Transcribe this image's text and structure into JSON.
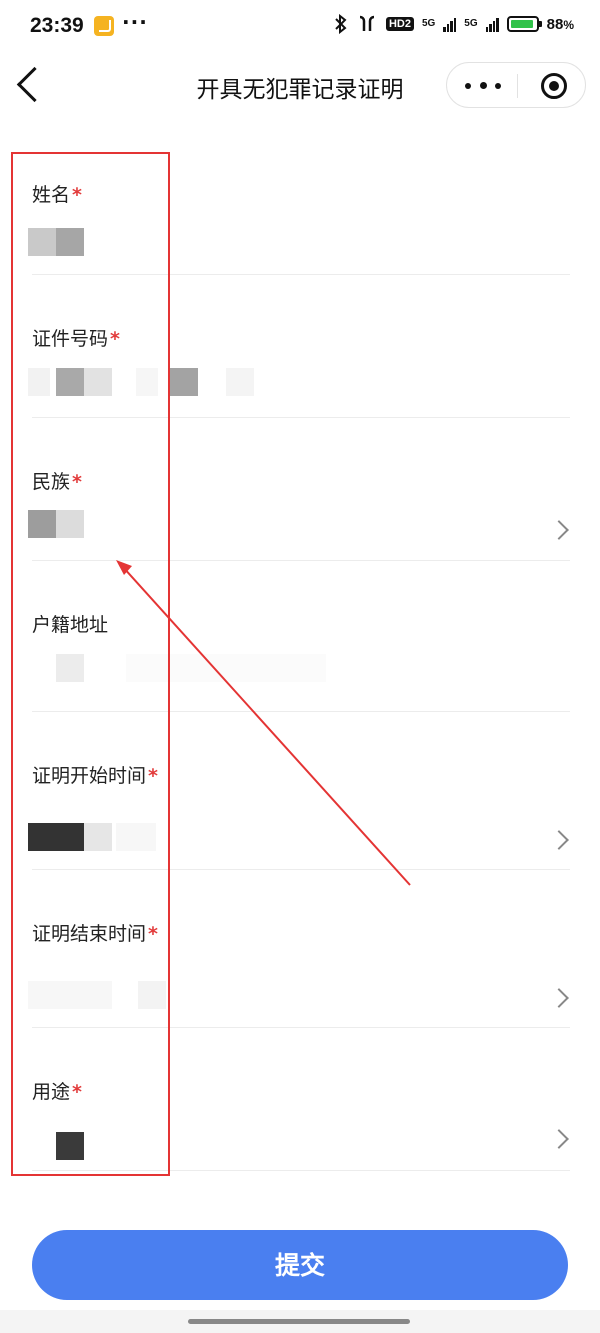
{
  "status_bar": {
    "time": "23:39",
    "network_hd": "HD2",
    "net_5g_a": "5G",
    "net_5g_b": "5G",
    "battery_percent": "88",
    "percent_sign": "%"
  },
  "nav": {
    "title": "开具无犯罪记录证明"
  },
  "form": {
    "required_mark": "*",
    "fields": [
      {
        "label": "姓名",
        "required": true
      },
      {
        "label": "证件号码",
        "required": true
      },
      {
        "label": "民族",
        "required": true
      },
      {
        "label": "户籍地址",
        "required": false
      },
      {
        "label": "证明开始时间",
        "required": true
      },
      {
        "label": "证明结束时间",
        "required": true
      },
      {
        "label": "用途",
        "required": true
      }
    ]
  },
  "submit_label": "提交",
  "colors": {
    "primary": "#4a7ff0",
    "required": "#e23b3b",
    "annotation": "#e43434"
  },
  "icons": [
    "back-icon",
    "more-icon",
    "target-icon",
    "chevron-right-icon",
    "bluetooth-icon",
    "earbuds-icon",
    "signal-icon",
    "battery-icon"
  ]
}
